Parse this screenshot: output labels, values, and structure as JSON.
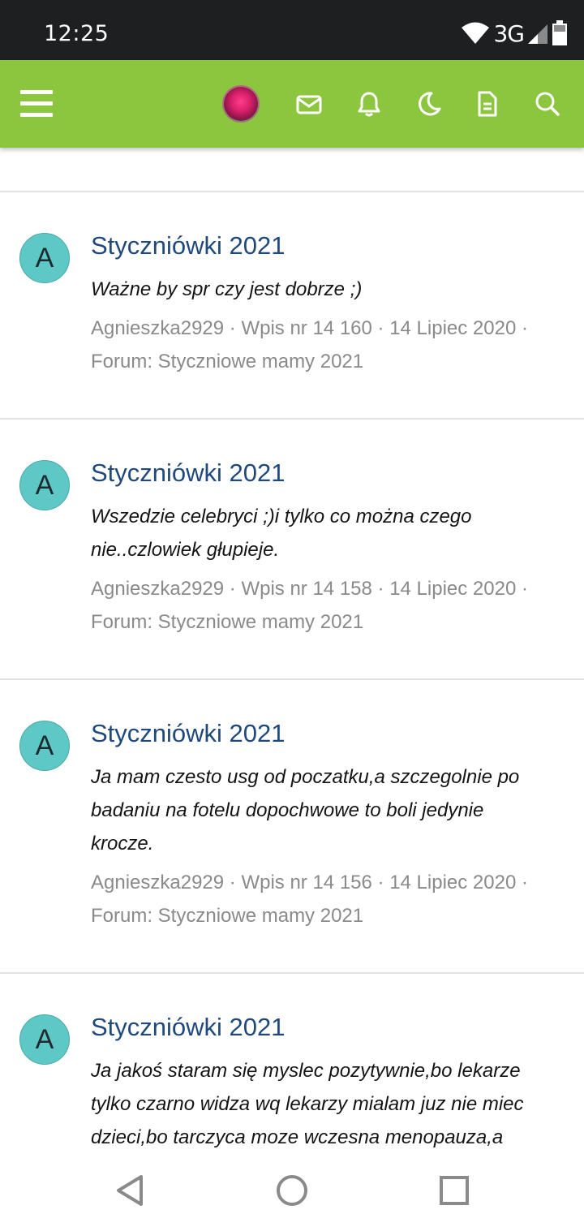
{
  "status_bar": {
    "time": "12:25",
    "network": "3G",
    "icons": [
      "wifi-icon",
      "signal-icon",
      "battery-icon"
    ]
  },
  "app_bar": {
    "bg_color": "#8cc63f",
    "icons": [
      "menu-icon",
      "user-avatar",
      "mail-icon",
      "bell-icon",
      "moon-icon",
      "document-icon",
      "search-icon"
    ]
  },
  "posts": [
    {
      "avatar_letter": "A",
      "title": "Styczniówki 2021",
      "snippet": [
        "Ważne by spr czy jest dobrze ;)"
      ],
      "meta": [
        "Agnieszka2929 · Wpis nr 14 160 · 14 Lipiec 2020 ·",
        "Forum: Styczniowe mamy 2021"
      ]
    },
    {
      "avatar_letter": "A",
      "title": "Styczniówki 2021",
      "snippet": [
        "Wszedzie celebryci ;)i tylko co można czego",
        "nie..czlowiek głupieje."
      ],
      "meta": [
        "Agnieszka2929 · Wpis nr 14 158 · 14 Lipiec 2020 ·",
        "Forum: Styczniowe mamy 2021"
      ]
    },
    {
      "avatar_letter": "A",
      "title": "Styczniówki 2021",
      "snippet": [
        "Ja mam czesto usg od poczatku,a szczegolnie po",
        "badaniu na fotelu dopochwowe to boli jedynie",
        "krocze."
      ],
      "meta": [
        "Agnieszka2929 · Wpis nr 14 156 · 14 Lipiec 2020 ·",
        "Forum: Styczniowe mamy 2021"
      ]
    },
    {
      "avatar_letter": "A",
      "title": "Styczniówki 2021",
      "snippet": [
        "Ja jakoś staram się myslec pozytywnie,bo lekarze",
        "tylko czarno widza wq lekarzy mialam juz nie miec",
        "dzieci,bo tarczyca moze wczesna menopauza,a"
      ],
      "meta": []
    }
  ],
  "nav_bar": {
    "icons": [
      "back-icon",
      "home-icon",
      "recents-icon"
    ]
  }
}
